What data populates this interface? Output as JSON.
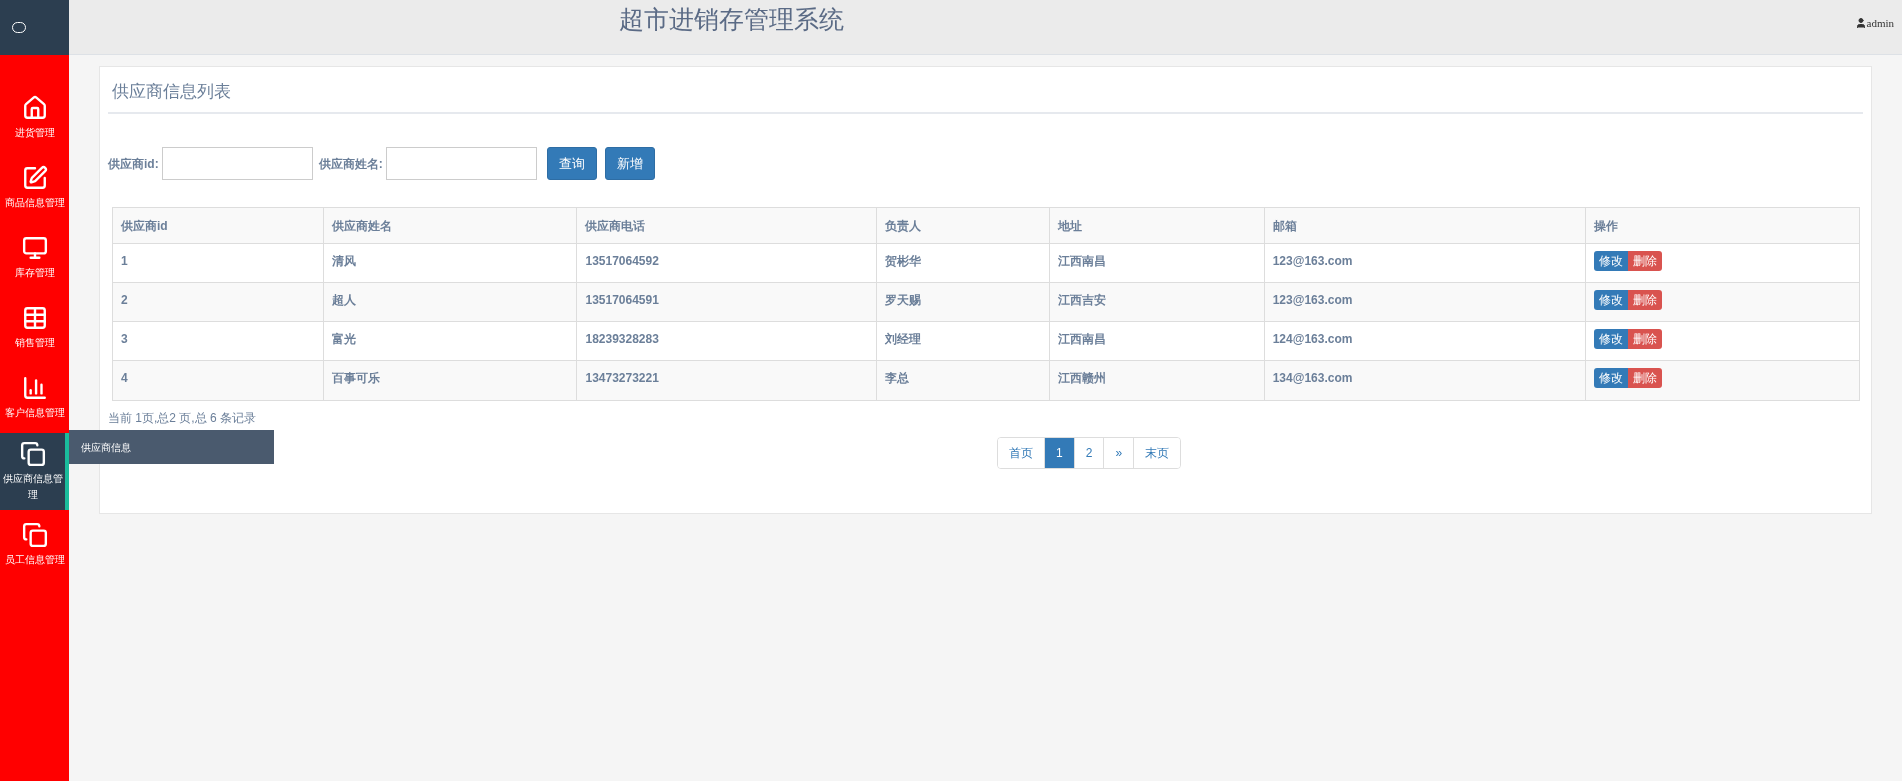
{
  "header": {
    "title": "超市进销存管理系统",
    "user": "admin"
  },
  "sidebar": {
    "items": [
      {
        "label": "进货管理",
        "kind": "home",
        "selected": false
      },
      {
        "label": "商品信息管理",
        "kind": "edit",
        "selected": false
      },
      {
        "label": "库存管理",
        "kind": "monitor",
        "selected": false
      },
      {
        "label": "销售管理",
        "kind": "table",
        "selected": false
      },
      {
        "label": "客户信息管理",
        "kind": "chart",
        "selected": false
      },
      {
        "label": "供应商信息管理",
        "kind": "copy",
        "selected": true,
        "submenu": [
          "供应商信息"
        ]
      },
      {
        "label": "员工信息管理",
        "kind": "copy",
        "selected": false
      }
    ]
  },
  "panel": {
    "title": "供应商信息列表",
    "search": {
      "fields": [
        {
          "label": "供应商id:"
        },
        {
          "label": "供应商姓名:"
        }
      ],
      "buttons": [
        "查询",
        "新增"
      ]
    },
    "table": {
      "columns": [
        "供应商id",
        "供应商姓名",
        "供应商电话",
        "负责人",
        "地址",
        "邮箱",
        "操作"
      ],
      "rows": [
        {
          "cells": [
            "1",
            "清风",
            "13517064592",
            "贺彬华",
            "江西南昌",
            "123@163.com"
          ],
          "actions": [
            "修改",
            "删除"
          ]
        },
        {
          "cells": [
            "2",
            "超人",
            "13517064591",
            "罗天赐",
            "江西吉安",
            "123@163.com"
          ],
          "actions": [
            "修改",
            "删除"
          ]
        },
        {
          "cells": [
            "3",
            "富光",
            "18239328283",
            "刘经理",
            "江西南昌",
            "124@163.com"
          ],
          "actions": [
            "修改",
            "删除"
          ]
        },
        {
          "cells": [
            "4",
            "百事可乐",
            "13473273221",
            "李总",
            "江西赣州",
            "134@163.com"
          ],
          "actions": [
            "修改",
            "删除"
          ]
        }
      ]
    },
    "summary": "当前 1页,总2 页,总 6 条记录",
    "pagination": [
      {
        "label": "首页",
        "selected": false
      },
      {
        "label": "1",
        "selected": true
      },
      {
        "label": "2",
        "selected": false
      },
      {
        "label": "»",
        "selected": false
      },
      {
        "label": "末页",
        "selected": false
      }
    ]
  }
}
